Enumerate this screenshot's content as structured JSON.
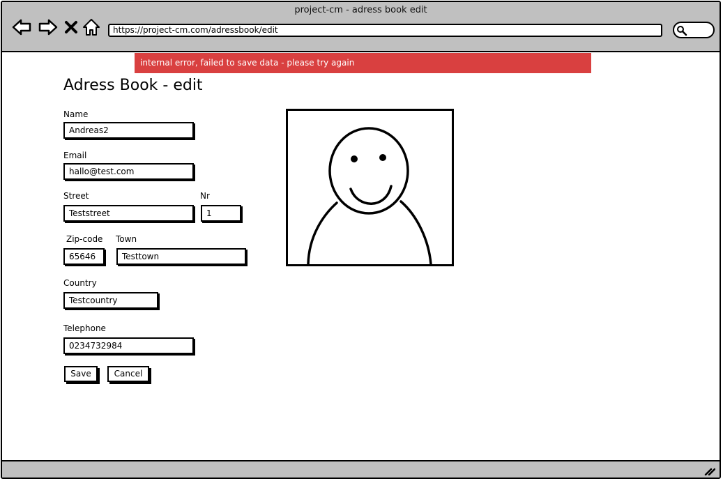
{
  "window": {
    "title": "project-cm - adress book edit"
  },
  "toolbar": {
    "back_icon": "back-arrow-icon",
    "forward_icon": "forward-arrow-icon",
    "stop_icon": "close-icon",
    "home_icon": "home-icon",
    "url": "https://project-cm.com/adressbook/edit",
    "search_icon": "search-icon"
  },
  "alert": {
    "message": "internal error, failed to save data - please try again",
    "color": "#d94040"
  },
  "page": {
    "title": "Adress Book - edit"
  },
  "form": {
    "name": {
      "label": "Name",
      "value": "Andreas2"
    },
    "email": {
      "label": "Email",
      "value": "hallo@test.com"
    },
    "street": {
      "label": "Street",
      "value": "Teststreet"
    },
    "nr": {
      "label": "Nr",
      "value": "1"
    },
    "zip": {
      "label": "Zip-code",
      "value": "65646"
    },
    "town": {
      "label": "Town",
      "value": "Testtown"
    },
    "country": {
      "label": "Country",
      "value": "Testcountry"
    },
    "telephone": {
      "label": "Telephone",
      "value": "0234732984"
    }
  },
  "buttons": {
    "save": "Save",
    "cancel": "Cancel"
  },
  "photo": {
    "icon": "smiley-person-icon"
  }
}
